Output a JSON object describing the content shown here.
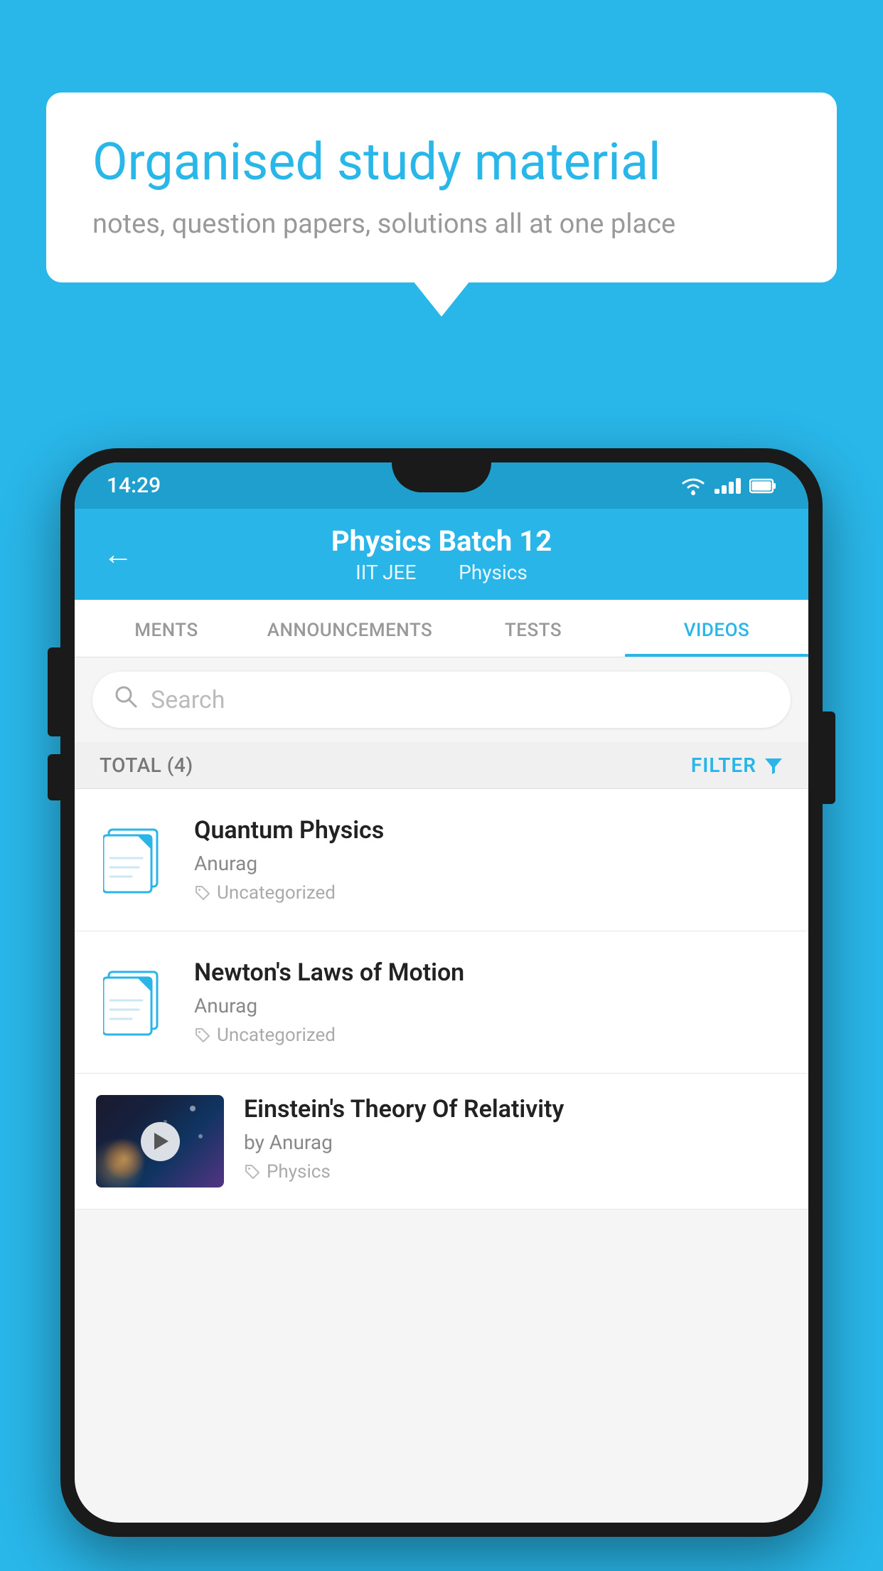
{
  "page": {
    "background_color": "#29b6e8"
  },
  "speech_bubble": {
    "title": "Organised study material",
    "subtitle": "notes, question papers, solutions all at one place"
  },
  "phone": {
    "status_bar": {
      "time": "14:29"
    },
    "header": {
      "title": "Physics Batch 12",
      "subtitle_part1": "IIT JEE",
      "subtitle_part2": "Physics",
      "back_label": "←"
    },
    "tabs": [
      {
        "label": "MENTS",
        "active": false
      },
      {
        "label": "ANNOUNCEMENTS",
        "active": false
      },
      {
        "label": "TESTS",
        "active": false
      },
      {
        "label": "VIDEOS",
        "active": true
      }
    ],
    "search": {
      "placeholder": "Search"
    },
    "filter": {
      "total_label": "TOTAL (4)",
      "filter_label": "FILTER"
    },
    "videos": [
      {
        "title": "Quantum Physics",
        "author": "Anurag",
        "tag": "Uncategorized",
        "has_thumbnail": false
      },
      {
        "title": "Newton's Laws of Motion",
        "author": "Anurag",
        "tag": "Uncategorized",
        "has_thumbnail": false
      },
      {
        "title": "Einstein's Theory Of Relativity",
        "author": "by Anurag",
        "tag": "Physics",
        "has_thumbnail": true
      }
    ]
  }
}
